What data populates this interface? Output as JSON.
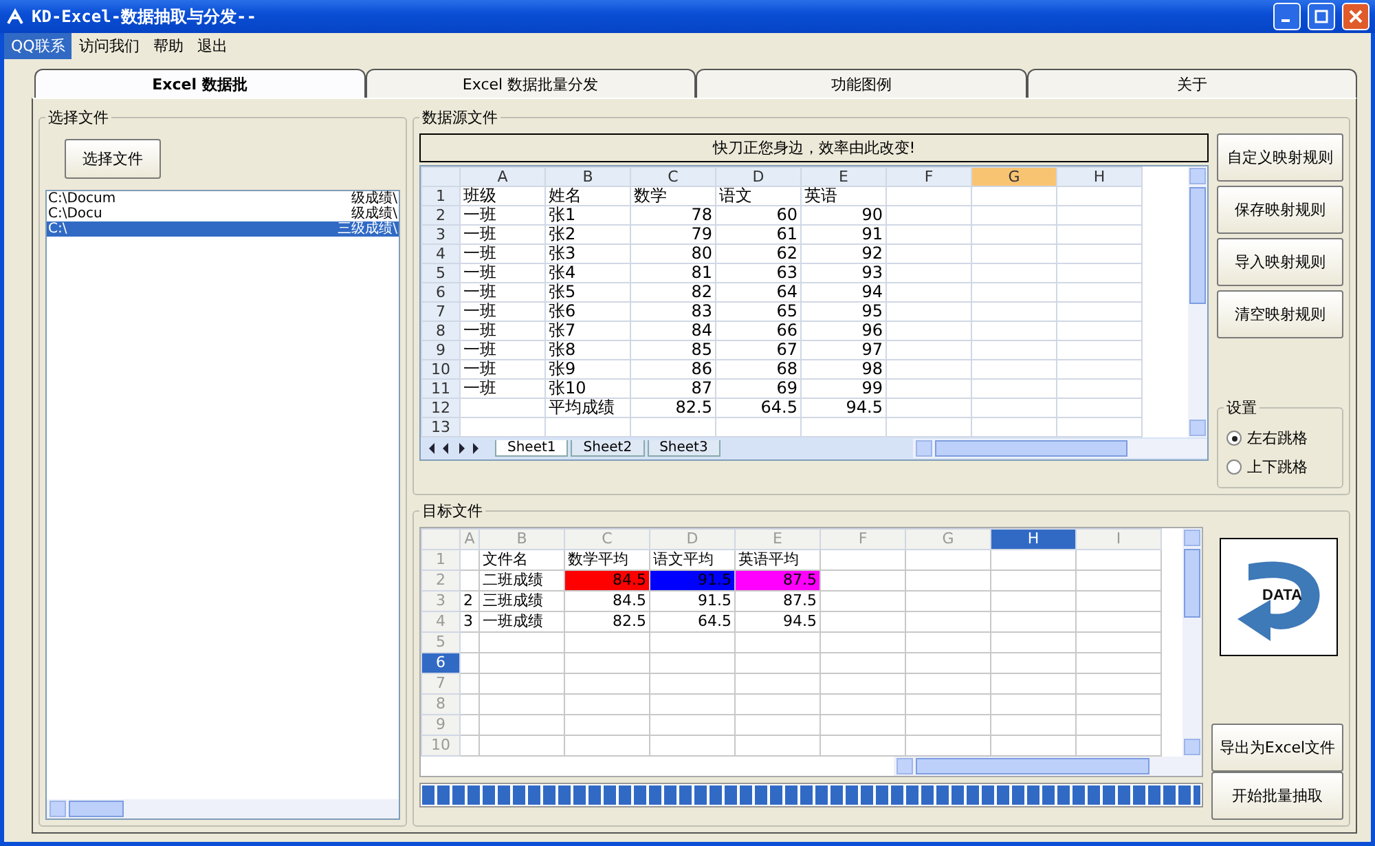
{
  "window": {
    "title": "KD-Excel-数据抽取与分发--"
  },
  "menu": [
    {
      "label": "QQ联系",
      "selected": true
    },
    {
      "label": "访问我们",
      "selected": false
    },
    {
      "label": "帮助",
      "selected": false
    },
    {
      "label": "退出",
      "selected": false
    }
  ],
  "tabs": [
    {
      "label": "Excel 数据批",
      "selected": true
    },
    {
      "label": "Excel 数据批量分发",
      "selected": false
    },
    {
      "label": "功能图例",
      "selected": false
    },
    {
      "label": "关于",
      "selected": false
    }
  ],
  "file_group": {
    "title": "选择文件",
    "button": "选择文件",
    "files": [
      {
        "start": "C:\\Docum",
        "end": "级成绩\\",
        "selected": false
      },
      {
        "start": "C:\\Docu",
        "end": "级成绩\\",
        "selected": false
      },
      {
        "start": "C:\\",
        "end": "三级成绩\\",
        "selected": true
      }
    ]
  },
  "source": {
    "title": "数据源文件",
    "banner": "快刀正您身边，效率由此改变!",
    "columns": [
      {
        "label": "A",
        "selected": false
      },
      {
        "label": "B",
        "selected": false
      },
      {
        "label": "C",
        "selected": false
      },
      {
        "label": "D",
        "selected": false
      },
      {
        "label": "E",
        "selected": false
      },
      {
        "label": "F",
        "selected": false
      },
      {
        "label": "G",
        "selected": true
      },
      {
        "label": "H",
        "selected": false
      }
    ],
    "rows": [
      {
        "header": "1",
        "kind": "header",
        "cells": [
          "班级",
          "姓名",
          "数学",
          "语文",
          "英语"
        ]
      },
      {
        "header": "2",
        "kind": "data",
        "cells": [
          "一班",
          "张1",
          "78",
          "60",
          "90"
        ]
      },
      {
        "header": "3",
        "kind": "data",
        "cells": [
          "一班",
          "张2",
          "79",
          "61",
          "91"
        ]
      },
      {
        "header": "4",
        "kind": "data",
        "cells": [
          "一班",
          "张3",
          "80",
          "62",
          "92"
        ]
      },
      {
        "header": "5",
        "kind": "data",
        "cells": [
          "一班",
          "张4",
          "81",
          "63",
          "93"
        ]
      },
      {
        "header": "6",
        "kind": "data",
        "cells": [
          "一班",
          "张5",
          "82",
          "64",
          "94"
        ]
      },
      {
        "header": "7",
        "kind": "data",
        "cells": [
          "一班",
          "张6",
          "83",
          "65",
          "95"
        ]
      },
      {
        "header": "8",
        "kind": "data",
        "cells": [
          "一班",
          "张7",
          "84",
          "66",
          "96"
        ]
      },
      {
        "header": "9",
        "kind": "data",
        "cells": [
          "一班",
          "张8",
          "85",
          "67",
          "97"
        ]
      },
      {
        "header": "10",
        "kind": "data",
        "cells": [
          "一班",
          "张9",
          "86",
          "68",
          "98"
        ]
      },
      {
        "header": "11",
        "kind": "data",
        "cells": [
          "一班",
          "张10",
          "87",
          "69",
          "99"
        ]
      },
      {
        "header": "12",
        "kind": "data",
        "cells": [
          "",
          "平均成绩",
          "82.5",
          "64.5",
          "94.5"
        ]
      },
      {
        "header": "13",
        "kind": "data",
        "cells": []
      }
    ],
    "sheets": [
      {
        "label": "Sheet1",
        "selected": true
      },
      {
        "label": "Sheet2",
        "selected": false
      },
      {
        "label": "Sheet3",
        "selected": false
      }
    ],
    "buttons": [
      "自定义映射规则",
      "保存映射规则",
      "导入映射规则",
      "清空映射规则"
    ],
    "settings": {
      "title": "设置",
      "options": [
        {
          "label": "左右跳格",
          "selected": true
        },
        {
          "label": "上下跳格",
          "selected": false
        }
      ]
    }
  },
  "target": {
    "title": "目标文件",
    "columns": [
      {
        "label": "A",
        "selected": false
      },
      {
        "label": "B",
        "selected": false
      },
      {
        "label": "C",
        "selected": false
      },
      {
        "label": "D",
        "selected": false
      },
      {
        "label": "E",
        "selected": false
      },
      {
        "label": "F",
        "selected": false
      },
      {
        "label": "G",
        "selected": false
      },
      {
        "label": "H",
        "selected": true
      },
      {
        "label": "I",
        "selected": false
      }
    ],
    "rows": [
      {
        "header": "1",
        "kind": "header",
        "selected": false,
        "cells": [
          {
            "text": ""
          },
          {
            "text": "文件名"
          },
          {
            "text": "数学平均"
          },
          {
            "text": "语文平均"
          },
          {
            "text": "英语平均"
          }
        ]
      },
      {
        "header": "2",
        "kind": "data",
        "selected": false,
        "cells": [
          {
            "text": ""
          },
          {
            "text": "二班成绩"
          },
          {
            "text": "84.5",
            "color": "#ff0000"
          },
          {
            "text": "91.5",
            "color": "#0000ff"
          },
          {
            "text": "87.5",
            "color": "#ff00ff"
          }
        ]
      },
      {
        "header": "3",
        "kind": "data",
        "selected": false,
        "cells": [
          {
            "text": "2"
          },
          {
            "text": "三班成绩"
          },
          {
            "text": "84.5"
          },
          {
            "text": "91.5"
          },
          {
            "text": "87.5"
          }
        ]
      },
      {
        "header": "4",
        "kind": "data",
        "selected": false,
        "cells": [
          {
            "text": "3"
          },
          {
            "text": "一班成绩"
          },
          {
            "text": "82.5"
          },
          {
            "text": "64.5"
          },
          {
            "text": "94.5"
          }
        ]
      },
      {
        "header": "5",
        "kind": "data",
        "selected": false,
        "cells": []
      },
      {
        "header": "6",
        "kind": "data",
        "selected": true,
        "cells": []
      },
      {
        "header": "7",
        "kind": "data",
        "selected": false,
        "cells": []
      },
      {
        "header": "8",
        "kind": "data",
        "selected": false,
        "cells": []
      },
      {
        "header": "9",
        "kind": "data",
        "selected": false,
        "cells": []
      },
      {
        "header": "10",
        "kind": "data",
        "selected": false,
        "cells": []
      }
    ],
    "progress": {
      "level": 1
    },
    "logo_text": "DATA",
    "buttons": [
      "导出为Excel文件",
      "开始批量抽取"
    ]
  }
}
